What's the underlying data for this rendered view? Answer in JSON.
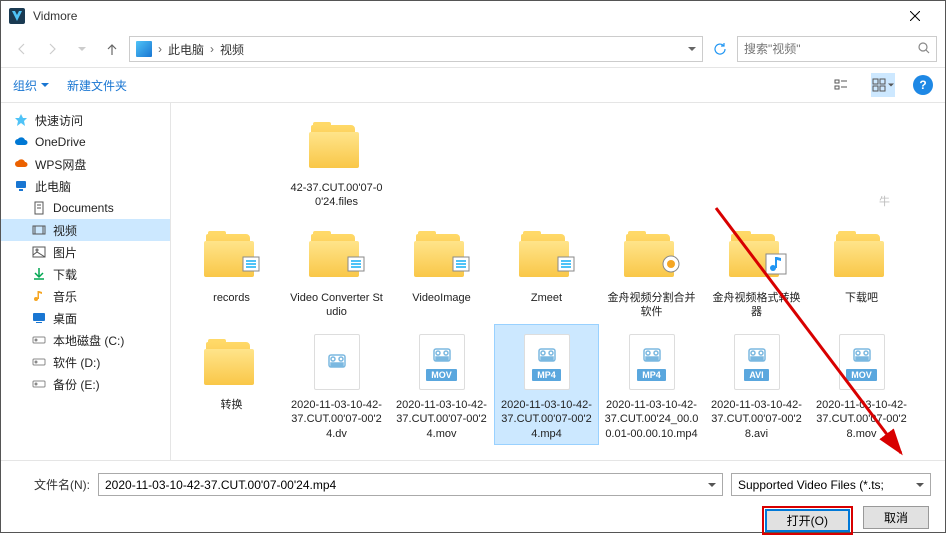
{
  "window": {
    "title": "Vidmore"
  },
  "nav": {
    "crumbs": [
      "此电脑",
      "视频"
    ],
    "search_placeholder": "搜索\"视频\""
  },
  "toolbar": {
    "organize": "组织",
    "newfolder": "新建文件夹"
  },
  "sidebar": {
    "items": [
      {
        "icon": "star",
        "label": "快速访问",
        "color": "#4fc3f7"
      },
      {
        "icon": "cloud",
        "label": "OneDrive",
        "color": "#0078d4"
      },
      {
        "icon": "cloud",
        "label": "WPS网盘",
        "color": "#eb6100"
      },
      {
        "icon": "pc",
        "label": "此电脑",
        "color": "#1976d2"
      },
      {
        "icon": "doc",
        "label": "Documents",
        "sub": true,
        "color": "#555"
      },
      {
        "icon": "video",
        "label": "视频",
        "sub": true,
        "sel": true,
        "color": "#555"
      },
      {
        "icon": "image",
        "label": "图片",
        "sub": true,
        "color": "#555"
      },
      {
        "icon": "download",
        "label": "下载",
        "sub": true,
        "color": "#00a651"
      },
      {
        "icon": "music",
        "label": "音乐",
        "sub": true,
        "color": "#f5a623"
      },
      {
        "icon": "desktop",
        "label": "桌面",
        "sub": true,
        "color": "#1976d2"
      },
      {
        "icon": "disk",
        "label": "本地磁盘 (C:)",
        "sub": true,
        "color": "#888"
      },
      {
        "icon": "disk",
        "label": "软件 (D:)",
        "sub": true,
        "color": "#888"
      },
      {
        "icon": "disk",
        "label": "备份 (E:)",
        "sub": true,
        "color": "#888"
      }
    ]
  },
  "truncated": {
    "label": "42-37.CUT.00'07-00'24.files",
    "rlabel": "牛"
  },
  "files": [
    {
      "type": "folder",
      "label": "records",
      "overlay": "list"
    },
    {
      "type": "folder",
      "label": "Video Converter Studio",
      "overlay": "list"
    },
    {
      "type": "folder",
      "label": "VideoImage",
      "overlay": "list"
    },
    {
      "type": "folder",
      "label": "Zmeet",
      "overlay": "list"
    },
    {
      "type": "folder",
      "label": "金舟视频分割合并软件",
      "overlay": "gear"
    },
    {
      "type": "folder",
      "label": "金舟视频格式转换器",
      "overlay": "music"
    },
    {
      "type": "folder",
      "label": "下载吧"
    },
    {
      "type": "folder",
      "label": "转换"
    },
    {
      "type": "file",
      "ext": "dv",
      "label": "2020-11-03-10-42-37.CUT.00'07-00'24.dv",
      "badge": "",
      "bcolor": "#fff"
    },
    {
      "type": "file",
      "ext": "mov",
      "label": "2020-11-03-10-42-37.CUT.00'07-00'24.mov",
      "badge": "MOV",
      "bcolor": "#5aa7de"
    },
    {
      "type": "file",
      "ext": "mp4",
      "label": "2020-11-03-10-42-37.CUT.00'07-00'24.mp4",
      "badge": "MP4",
      "bcolor": "#5aa7de",
      "sel": true
    },
    {
      "type": "file",
      "ext": "mp4",
      "label": "2020-11-03-10-42-37.CUT.00'24_00.00.01-00.00.10.mp4",
      "badge": "MP4",
      "bcolor": "#5aa7de"
    },
    {
      "type": "file",
      "ext": "avi",
      "label": "2020-11-03-10-42-37.CUT.00'07-00'28.avi",
      "badge": "AVI",
      "bcolor": "#5aa7de"
    },
    {
      "type": "file",
      "ext": "mov",
      "label": "2020-11-03-10-42-37.CUT.00'07-00'28.mov",
      "badge": "MOV",
      "bcolor": "#5aa7de"
    }
  ],
  "bottom": {
    "filename_label": "文件名(N):",
    "filename_value": "2020-11-03-10-42-37.CUT.00'07-00'24.mp4",
    "filetype": "Supported Video Files (*.ts; ",
    "open": "打开(O)",
    "cancel": "取消"
  }
}
